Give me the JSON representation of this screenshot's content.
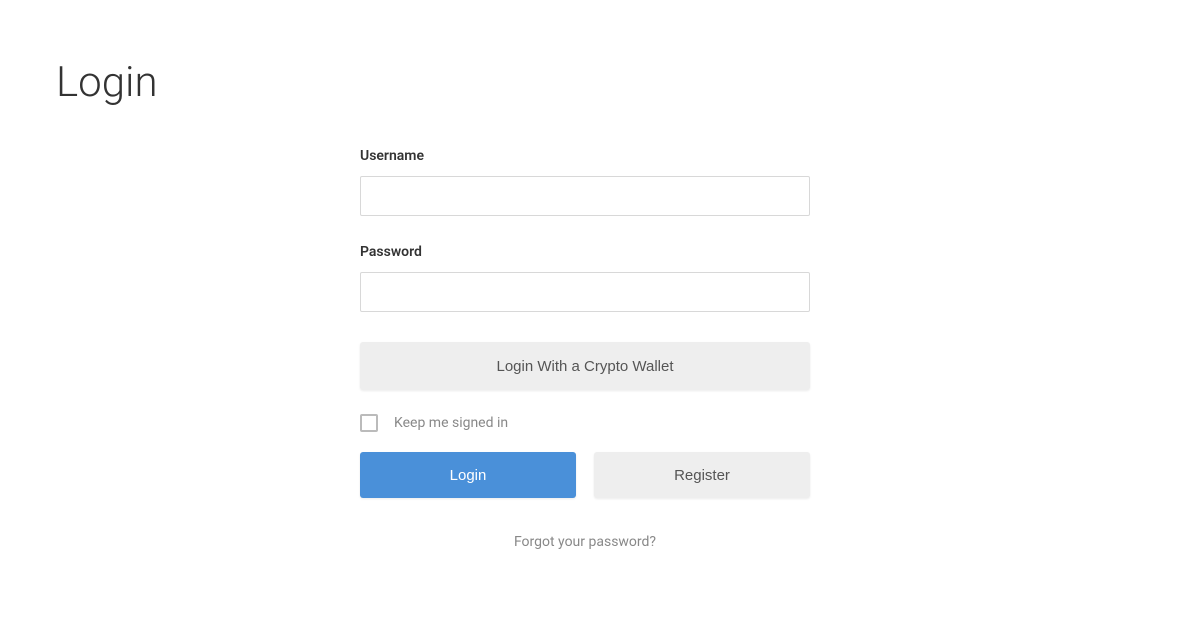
{
  "page": {
    "title": "Login"
  },
  "form": {
    "username_label": "Username",
    "username_value": "",
    "password_label": "Password",
    "password_value": "",
    "crypto_button_label": "Login With a Crypto Wallet",
    "keep_signed_in_label": "Keep me signed in",
    "keep_signed_in_checked": false,
    "login_button_label": "Login",
    "register_button_label": "Register",
    "forgot_password_label": "Forgot your password?"
  }
}
